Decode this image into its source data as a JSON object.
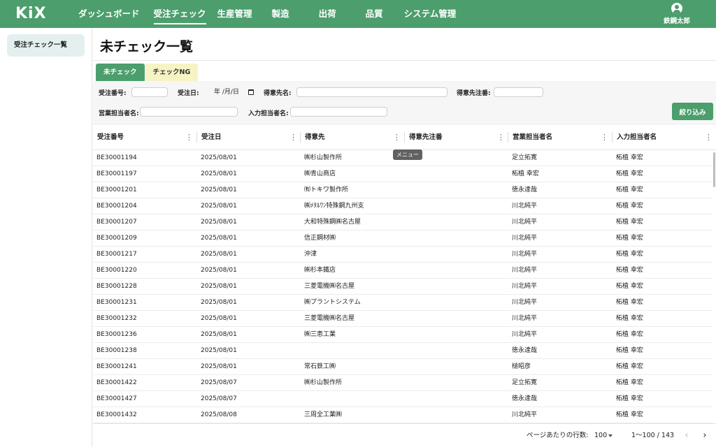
{
  "header": {
    "logo": "KiX",
    "nav": [
      {
        "label": "ダッシュボード",
        "active": false
      },
      {
        "label": "受注チェック",
        "active": true
      },
      {
        "label": "生産管理",
        "active": false
      },
      {
        "label": "製造",
        "active": false
      },
      {
        "label": "出荷",
        "active": false
      },
      {
        "label": "品質",
        "active": false
      },
      {
        "label": "システム管理",
        "active": false
      }
    ],
    "user_name": "鉄鋼太郎"
  },
  "sidebar": {
    "items": [
      {
        "label": "受注チェック一覧",
        "active": true
      }
    ]
  },
  "main": {
    "title": "未チェック一覧",
    "tabs": [
      {
        "label": "未チェック",
        "active": true
      },
      {
        "label": "チェックNG",
        "active": false
      }
    ]
  },
  "filters": {
    "order_no_label": "受注番号:",
    "order_date_label": "受注日:",
    "order_date_placeholder": "年 /月/日",
    "customer_label": "得意先名:",
    "customer_order_label": "得意先注番:",
    "sales_rep_label": "営業担当者名:",
    "entry_rep_label": "入力担当者名:",
    "narrow_button": "絞り込み"
  },
  "grid": {
    "columns": [
      "受注番号",
      "受注日",
      "得意先",
      "得意先注番",
      "営業担当者名",
      "入力担当者名"
    ],
    "rows": [
      [
        "BE30001194",
        "2025/08/01",
        "㈱杉山製作所",
        "",
        "足立拓寛",
        "柘植 幸宏"
      ],
      [
        "BE30001197",
        "2025/08/01",
        "㈱青山商店",
        "",
        "柘植 幸宏",
        "柘植 幸宏"
      ],
      [
        "BE30001201",
        "2025/08/01",
        "㈲トキワ製作所",
        "",
        "徳永達哉",
        "柘植 幸宏"
      ],
      [
        "BE30001204",
        "2025/08/01",
        "㈱ﾒﾀﾙﾜﾝ特殊鋼九州支",
        "",
        "川北純平",
        "柘植 幸宏"
      ],
      [
        "BE30001207",
        "2025/08/01",
        "大和特殊鋼㈱名古屋",
        "",
        "川北純平",
        "柘植 幸宏"
      ],
      [
        "BE30001209",
        "2025/08/01",
        "信正鋼材㈱",
        "",
        "川北純平",
        "柘植 幸宏"
      ],
      [
        "BE30001217",
        "2025/08/01",
        "沖津",
        "",
        "川北純平",
        "柘植 幸宏"
      ],
      [
        "BE30001220",
        "2025/08/01",
        "㈱杉本鐵店",
        "",
        "川北純平",
        "柘植 幸宏"
      ],
      [
        "BE30001228",
        "2025/08/01",
        "三菱電機㈱名古屋",
        "",
        "川北純平",
        "柘植 幸宏"
      ],
      [
        "BE30001231",
        "2025/08/01",
        "㈱プラントシステム",
        "",
        "川北純平",
        "柘植 幸宏"
      ],
      [
        "BE30001232",
        "2025/08/01",
        "三菱電機㈱名古屋",
        "",
        "川北純平",
        "柘植 幸宏"
      ],
      [
        "BE30001236",
        "2025/08/01",
        "㈱三恵工業",
        "",
        "川北純平",
        "柘植 幸宏"
      ],
      [
        "BE30001238",
        "2025/08/01",
        "",
        "",
        "徳永達哉",
        "柘植 幸宏"
      ],
      [
        "BE30001241",
        "2025/08/01",
        "常石鉄工㈱",
        "",
        "槌昭彦",
        "柘植 幸宏"
      ],
      [
        "BE30001422",
        "2025/08/07",
        "㈱杉山製作所",
        "",
        "足立拓寛",
        "柘植 幸宏"
      ],
      [
        "BE30001427",
        "2025/08/07",
        "",
        "",
        "徳永達哉",
        "柘植 幸宏"
      ],
      [
        "BE30001432",
        "2025/08/08",
        "三周全工業㈱",
        "",
        "川北純平",
        "柘植 幸宏"
      ]
    ]
  },
  "tooltip": "メニュー",
  "pagination": {
    "rows_per_page_label": "ページあたりの行数:",
    "rows_per_page": "100",
    "range": "1〜100 / 143",
    "prev": "‹",
    "next": "›"
  },
  "icons": {
    "user": "user-circle-icon",
    "calendar": "calendar-icon",
    "column_menu": "more-vert-icon",
    "caret": "caret-down-icon"
  },
  "colors": {
    "brand": "#4c9e6d",
    "tab_inactive": "#f6f4c3",
    "sidebar_active": "#e4f0f0"
  }
}
